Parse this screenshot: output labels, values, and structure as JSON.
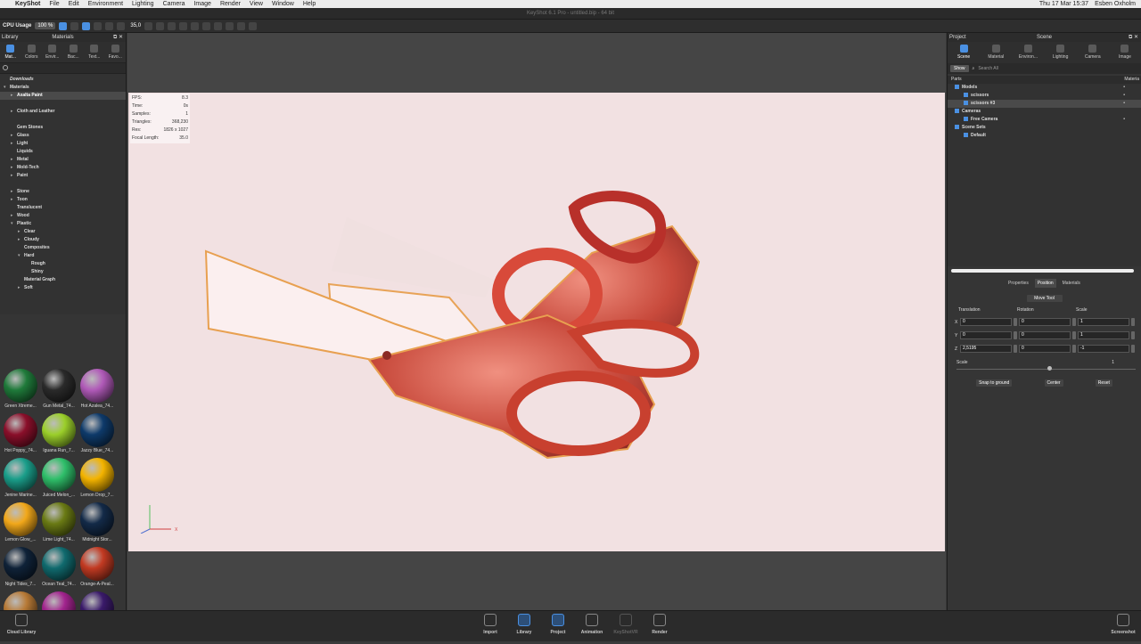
{
  "menubar": {
    "app": "KeyShot",
    "items": [
      "File",
      "Edit",
      "Environment",
      "Lighting",
      "Camera",
      "Image",
      "Render",
      "View",
      "Window",
      "Help"
    ],
    "clock": "Thu 17 Mar  15:37",
    "user": "Esben Oxholm"
  },
  "window": {
    "title": "KeyShot 6.1 Pro - untitled.bip - 64 bit"
  },
  "toolbar": {
    "cpu_label": "CPU Usage",
    "cpu_value": "100 %",
    "focal": "35,0"
  },
  "left_panel": {
    "header_left": "Library",
    "header_center": "Materials",
    "tabs": [
      "Mat...",
      "Colors",
      "Envir...",
      "Bac...",
      "Text...",
      "Favo..."
    ],
    "tree": [
      {
        "label": "Downloads",
        "level": 0,
        "arrow": "",
        "selected": false,
        "header": true
      },
      {
        "label": "Materials",
        "level": 0,
        "arrow": "▾",
        "selected": false
      },
      {
        "label": "Axalta Paint",
        "level": 1,
        "arrow": "▸",
        "selected": true
      },
      {
        "label": "",
        "level": 1,
        "arrow": "",
        "selected": false
      },
      {
        "label": "Cloth and Leather",
        "level": 1,
        "arrow": "▸",
        "selected": false
      },
      {
        "label": "",
        "level": 1,
        "arrow": "",
        "selected": false
      },
      {
        "label": "Gem Stones",
        "level": 1,
        "arrow": "",
        "selected": false
      },
      {
        "label": "Glass",
        "level": 1,
        "arrow": "▸",
        "selected": false
      },
      {
        "label": "Light",
        "level": 1,
        "arrow": "▸",
        "selected": false
      },
      {
        "label": "Liquids",
        "level": 1,
        "arrow": "",
        "selected": false
      },
      {
        "label": "Metal",
        "level": 1,
        "arrow": "▸",
        "selected": false
      },
      {
        "label": "Mold-Tech",
        "level": 1,
        "arrow": "▸",
        "selected": false
      },
      {
        "label": "Paint",
        "level": 1,
        "arrow": "▸",
        "selected": false
      },
      {
        "label": "",
        "level": 1,
        "arrow": "",
        "selected": false
      },
      {
        "label": "Stone",
        "level": 1,
        "arrow": "▸",
        "selected": false
      },
      {
        "label": "Toon",
        "level": 1,
        "arrow": "▸",
        "selected": false
      },
      {
        "label": "Translucent",
        "level": 1,
        "arrow": "",
        "selected": false
      },
      {
        "label": "Wood",
        "level": 1,
        "arrow": "▸",
        "selected": false
      },
      {
        "label": "Plastic",
        "level": 1,
        "arrow": "▾",
        "selected": false
      },
      {
        "label": "Clear",
        "level": 2,
        "arrow": "▸",
        "selected": false
      },
      {
        "label": "Cloudy",
        "level": 2,
        "arrow": "▸",
        "selected": false
      },
      {
        "label": "Composites",
        "level": 2,
        "arrow": "",
        "selected": false
      },
      {
        "label": "Hard",
        "level": 2,
        "arrow": "▾",
        "selected": false
      },
      {
        "label": "Rough",
        "level": 3,
        "arrow": "",
        "selected": false
      },
      {
        "label": "Shiny",
        "level": 3,
        "arrow": "",
        "selected": false
      },
      {
        "label": "Material Graph",
        "level": 2,
        "arrow": "",
        "selected": false
      },
      {
        "label": "Soft",
        "level": 2,
        "arrow": "▸",
        "selected": false
      }
    ],
    "thumbnails": [
      {
        "name": "Green Xtreme...",
        "color": "#1f7a3a"
      },
      {
        "name": "Gun Metal_74...",
        "color": "#2a2a2a"
      },
      {
        "name": "Hot Azalea_74...",
        "color": "#b05ab8"
      },
      {
        "name": "Hot Poppy_74...",
        "color": "#8a0f2a"
      },
      {
        "name": "Iguana Run_7...",
        "color": "#9bcf2a"
      },
      {
        "name": "Jazzy Blue_74...",
        "color": "#0e3a6a"
      },
      {
        "name": "Jenine Marine...",
        "color": "#1a9e8a"
      },
      {
        "name": "Juiced Melon_...",
        "color": "#2fbf6a"
      },
      {
        "name": "Lemon Drop_7...",
        "color": "#f4b400"
      },
      {
        "name": "Lemon Glow_...",
        "color": "#f2a81a"
      },
      {
        "name": "Lime Light_74...",
        "color": "#6a7a14"
      },
      {
        "name": "Midnight Stor...",
        "color": "#132a48"
      },
      {
        "name": "Night Tides_7...",
        "color": "#0f2238"
      },
      {
        "name": "Ocean Teal_74...",
        "color": "#106a6e"
      },
      {
        "name": "Orange-A-Peal...",
        "color": "#c23a22"
      },
      {
        "name": "Pacific Gold_7...",
        "color": "#b87a36"
      },
      {
        "name": "Perplexed Pin...",
        "color": "#a2248e"
      },
      {
        "name": "Plum Crazy_7...",
        "color": "#3a1a6a"
      }
    ]
  },
  "viewport": {
    "bg_color": "#f2e1e2",
    "stats": [
      {
        "k": "FPS:",
        "v": "8.3"
      },
      {
        "k": "Time:",
        "v": "0s"
      },
      {
        "k": "Samples:",
        "v": "1"
      },
      {
        "k": "Triangles:",
        "v": "368,230"
      },
      {
        "k": "Res:",
        "v": "1826 x 1027"
      },
      {
        "k": "Focal Length:",
        "v": "35.0"
      }
    ],
    "axis_x_label": "X"
  },
  "right_panel": {
    "header_left": "Project",
    "header_center": "Scene",
    "tabs": [
      "Scene",
      "Material",
      "Environ...",
      "Lighting",
      "Camera",
      "Image"
    ],
    "show_label": "Show",
    "search_placeholder": "Search All",
    "col_parts": "Parts",
    "col_materials": "Materia",
    "tree": [
      {
        "label": "Models",
        "level": 0,
        "sel": false,
        "dot": true
      },
      {
        "label": "scissors",
        "level": 1,
        "sel": false,
        "dot": true
      },
      {
        "label": "scissors #3",
        "level": 1,
        "sel": true,
        "dot": true
      },
      {
        "label": "Cameras",
        "level": 0,
        "sel": false,
        "dot": false
      },
      {
        "label": "Free Camera",
        "level": 1,
        "sel": false,
        "dot": true
      },
      {
        "label": "Scene Sets",
        "level": 0,
        "sel": false,
        "dot": false
      },
      {
        "label": "Default",
        "level": 1,
        "sel": false,
        "dot": false
      }
    ],
    "subtabs": [
      "Properties",
      "Position",
      "Materials"
    ],
    "move_tool": "Move Tool",
    "tf_headers": [
      "Translation",
      "Rotation",
      "Scale"
    ],
    "rows": [
      {
        "axis": "X",
        "t": "0",
        "r": "0",
        "s": "1"
      },
      {
        "axis": "Y",
        "t": "0",
        "r": "0",
        "s": "1"
      },
      {
        "axis": "Z",
        "t": "2,5195",
        "r": "0",
        "s": "-1"
      }
    ],
    "scale_label": "Scale",
    "scale_value": "1",
    "buttons": [
      "Snap to ground",
      "Center",
      "Reset"
    ]
  },
  "dock": {
    "left": "Cloud Library",
    "items": [
      "Import",
      "Library",
      "Project",
      "Animation",
      "KeyShotVR",
      "Render"
    ],
    "right": "Screenshot"
  }
}
